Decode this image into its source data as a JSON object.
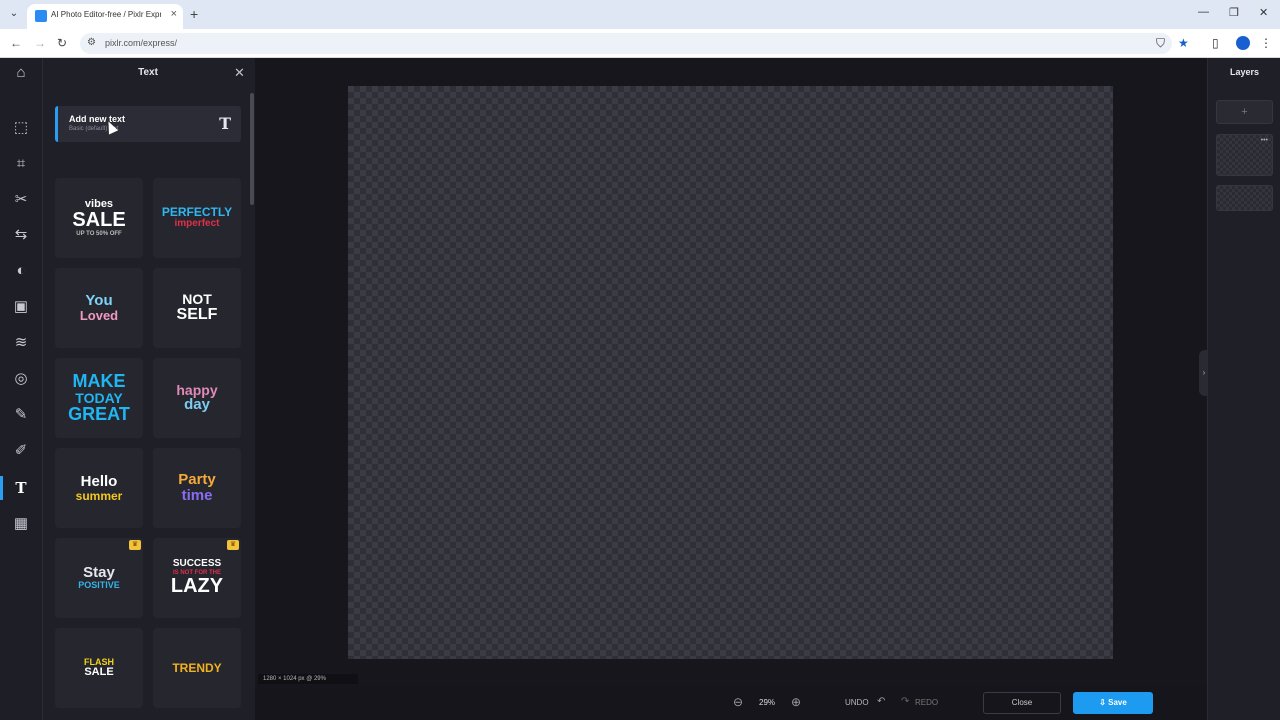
{
  "browser": {
    "tab_title": "AI Photo Editor-free / Pixlr Expr...",
    "tab_close": "×",
    "new_tab": "+",
    "url": "pixlr.com/express/",
    "minimize": "—",
    "restore": "❐",
    "close": "✕"
  },
  "panel": {
    "title": "Text",
    "close_glyph": "✕",
    "add_text_title": "Add new text",
    "add_text_sub": "Basic (default) text",
    "add_text_icon": "T"
  },
  "templates": [
    {
      "lines": [
        "vibes",
        "SALE",
        "UP TO 50% OFF"
      ],
      "colors": [
        "#ffffff",
        "#ffffff",
        "#bbbbbb"
      ],
      "premium": false
    },
    {
      "lines": [
        "PERFECTLY",
        "imperfect"
      ],
      "colors": [
        "#2fb7f0",
        "#e0304a"
      ],
      "premium": false
    },
    {
      "lines": [
        "You",
        "Loved"
      ],
      "colors": [
        "#7fd3f7",
        "#f09ac2"
      ],
      "premium": false
    },
    {
      "lines": [
        "NOT",
        "SELF"
      ],
      "colors": [
        "#ffffff",
        "#ffffff"
      ],
      "premium": false
    },
    {
      "lines": [
        "MAKE",
        "TODAY",
        "GREAT"
      ],
      "colors": [
        "#1fb6f2",
        "#1fb6f2",
        "#1fb6f2"
      ],
      "premium": false
    },
    {
      "lines": [
        "happy",
        "day"
      ],
      "colors": [
        "#e08ab8",
        "#7ecbf0"
      ],
      "premium": false
    },
    {
      "lines": [
        "Hello",
        "summer"
      ],
      "colors": [
        "#ffffff",
        "#f2c81e"
      ],
      "premium": false
    },
    {
      "lines": [
        "Party",
        "time"
      ],
      "colors": [
        "#f4a93b",
        "#8a6cf2"
      ],
      "premium": false
    },
    {
      "lines": [
        "Stay",
        "POSITIVE"
      ],
      "colors": [
        "#e6e6ee",
        "#37b4e6"
      ],
      "premium": true
    },
    {
      "lines": [
        "SUCCESS",
        "IS NOT FOR THE",
        "LAZY"
      ],
      "colors": [
        "#ffffff",
        "#e0304a",
        "#ffffff"
      ],
      "premium": true
    },
    {
      "lines": [
        "FLASH",
        "SALE"
      ],
      "colors": [
        "#f2d21e",
        "#ffffff"
      ],
      "premium": false
    },
    {
      "lines": [
        "TRENDY"
      ],
      "colors": [
        "#f2b21e"
      ],
      "premium": false
    }
  ],
  "workspace": {
    "info": "1280 × 1024 px @ 29%"
  },
  "layers": {
    "title": "Layers",
    "add_glyph": "+",
    "dots": "•••"
  },
  "bottom": {
    "zoom": "29%",
    "undo": "UNDO",
    "redo": "REDO",
    "close": "Close",
    "save": "Save"
  },
  "colors": {
    "accent": "#1d9bf0",
    "premium": "#f4c23b"
  }
}
